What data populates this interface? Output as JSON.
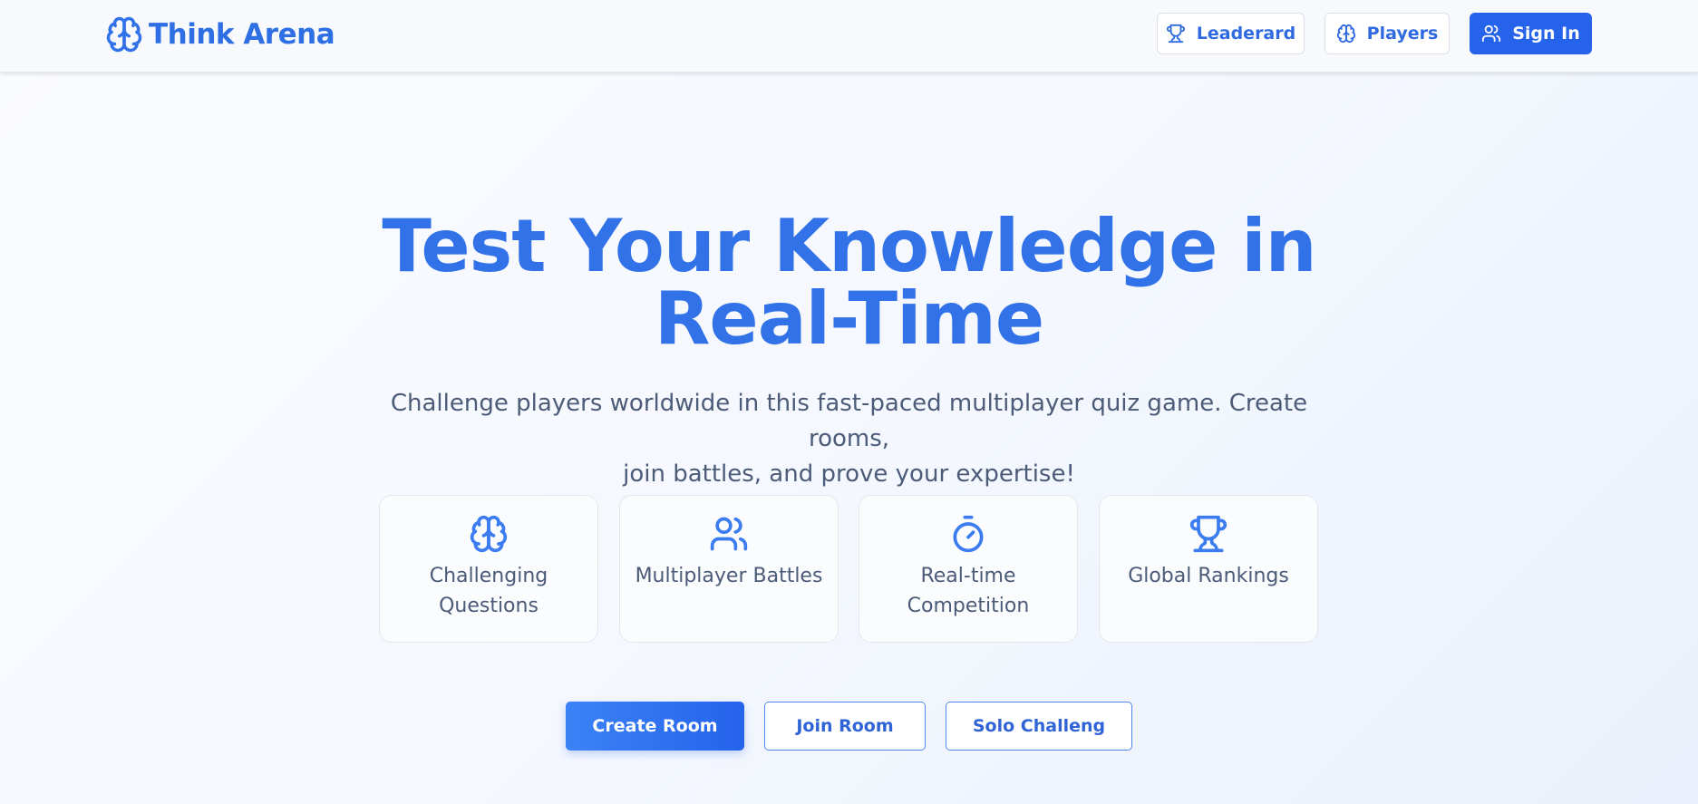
{
  "header": {
    "brand_title": "Think Arena",
    "nav": {
      "leaderboard_label": "Leaderard",
      "players_label": "Players",
      "signin_label": "Sign In"
    }
  },
  "hero": {
    "title_line1": "Test Your Knowledge in",
    "title_line2": "Real-Time",
    "subtitle_line1": "Challenge players worldwide in this fast-paced multiplayer quiz game. Create rooms,",
    "subtitle_line2": "join battles, and prove your expertise!"
  },
  "features": [
    {
      "icon": "brain-icon",
      "label": "Challenging Questions"
    },
    {
      "icon": "users-icon",
      "label": "Multiplayer Battles"
    },
    {
      "icon": "timer-icon",
      "label": "Real-time Competition"
    },
    {
      "icon": "trophy-icon",
      "label": "Global Rankings"
    }
  ],
  "actions": {
    "create_room": "Create Room",
    "join_room": "Join Room",
    "solo_challenge": "Solo Challeng"
  },
  "colors": {
    "accent": "#2563eb",
    "brand_text": "#2f6fe4",
    "body_text": "#4b5b78"
  }
}
